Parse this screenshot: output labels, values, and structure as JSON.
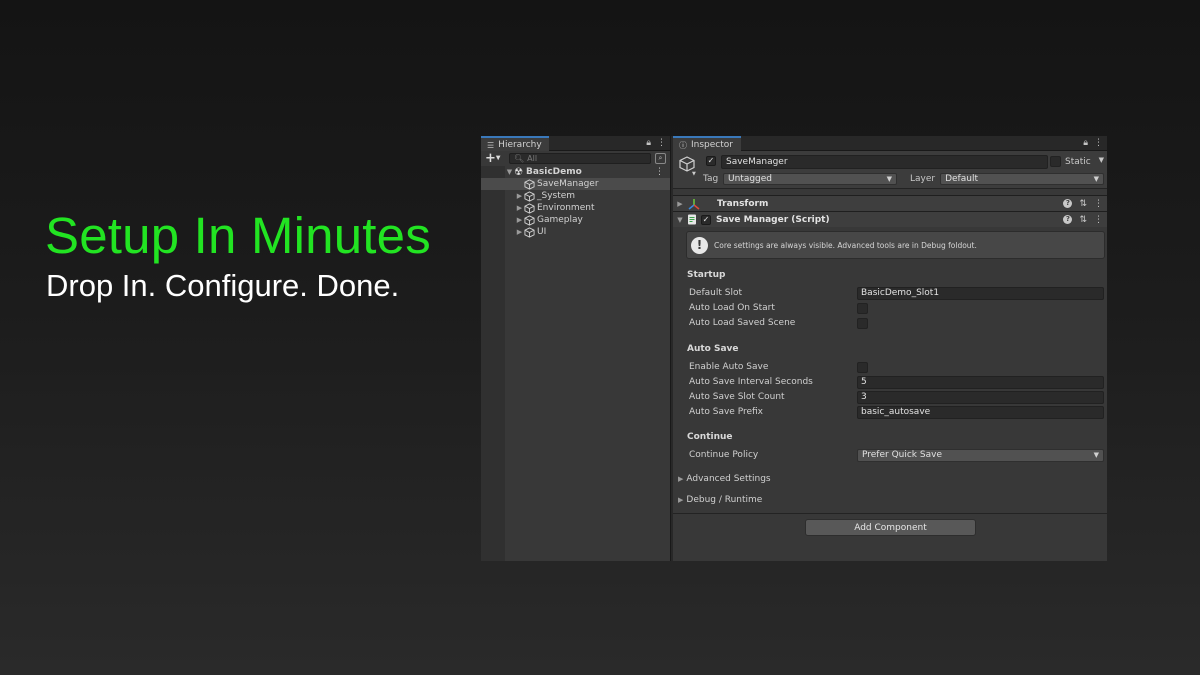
{
  "hero": {
    "title": "Setup In Minutes",
    "subtitle": "Drop In. Configure. Done."
  },
  "hierarchy": {
    "tab_label": "Hierarchy",
    "search_placeholder": "All",
    "scene": "BasicDemo",
    "items": [
      {
        "label": "SaveManager",
        "icon": "cube-icon",
        "selected": true,
        "expandable": false
      },
      {
        "label": "_System",
        "icon": "cube-icon",
        "selected": false,
        "expandable": true
      },
      {
        "label": "Environment",
        "icon": "cube-icon",
        "selected": false,
        "expandable": true
      },
      {
        "label": "Gameplay",
        "icon": "cube-icon",
        "selected": false,
        "expandable": true
      },
      {
        "label": "UI",
        "icon": "cube-icon",
        "selected": false,
        "expandable": true
      }
    ]
  },
  "inspector": {
    "tab_label": "Inspector",
    "object_name": "SaveManager",
    "static_label": "Static",
    "tag_label": "Tag",
    "tag_value": "Untagged",
    "layer_label": "Layer",
    "layer_value": "Default",
    "transform_title": "Transform",
    "script_title": "Save Manager (Script)",
    "help_text": "Core settings are always visible. Advanced tools are in Debug foldout.",
    "sections": {
      "startup": "Startup",
      "autosave": "Auto Save",
      "continue": "Continue"
    },
    "props": {
      "default_slot_label": "Default Slot",
      "default_slot_value": "BasicDemo_Slot1",
      "auto_load_on_start_label": "Auto Load On Start",
      "auto_load_saved_scene_label": "Auto Load Saved Scene",
      "enable_auto_save_label": "Enable Auto Save",
      "interval_label": "Auto Save Interval Seconds",
      "interval_value": "5",
      "slot_count_label": "Auto Save Slot Count",
      "slot_count_value": "3",
      "prefix_label": "Auto Save Prefix",
      "prefix_value": "basic_autosave",
      "continue_policy_label": "Continue Policy",
      "continue_policy_value": "Prefer Quick Save"
    },
    "foldouts": {
      "advanced": "Advanced Settings",
      "debug": "Debug / Runtime"
    },
    "add_component": "Add Component"
  },
  "colors": {
    "hero_accent": "#22e422",
    "selection_tab": "#3a79bb"
  }
}
